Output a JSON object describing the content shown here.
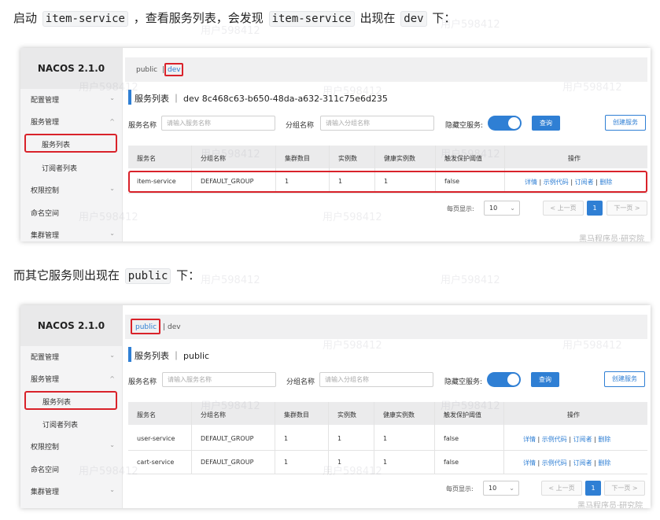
{
  "para1": {
    "prefix": "启动",
    "code1": "item-service",
    "middle": "，查看服务列表，会发现",
    "code2": "item-service",
    "middle2": "出现在",
    "code3": "dev",
    "suffix": "下："
  },
  "para2": {
    "prefix": "而其它服务则出现在",
    "code1": "public",
    "suffix": "下："
  },
  "shot1": {
    "logo": "NACOS 2.1.0",
    "menu": {
      "config": "配置管理",
      "service": "服务管理",
      "service_list": "服务列表",
      "subscriber_list": "订阅者列表",
      "auth": "权限控制",
      "namespace": "命名空间",
      "cluster": "集群管理"
    },
    "ns": {
      "public": "public",
      "sep": "|",
      "dev": "dev"
    },
    "title": "服务列表 ｜ dev  8c468c63-b650-48da-a632-311c75e6d235",
    "filters": {
      "service_label": "服务名称",
      "service_ph": "请输入服务名称",
      "group_label": "分组名称",
      "group_ph": "请输入分组名称",
      "hide_label": "隐藏空服务:",
      "query": "查询",
      "create": "创建服务"
    },
    "headers": [
      "服务名",
      "分组名称",
      "集群数目",
      "实例数",
      "健康实例数",
      "触发保护阈值",
      "操作"
    ],
    "rows": [
      {
        "name": "item-service",
        "group": "DEFAULT_GROUP",
        "clusters": "1",
        "instances": "1",
        "healthy": "1",
        "threshold": "false"
      }
    ],
    "ops": {
      "detail": "详情",
      "sample": "示例代码",
      "subscriber": "订阅者",
      "delete": "删除",
      "sep": "|"
    },
    "pager": {
      "label": "每页显示:",
      "size": "10",
      "prev": "< 上一页",
      "page": "1",
      "next": "下一页 >"
    },
    "footer_wm": "黑马程序员·研究院"
  },
  "shot2": {
    "logo": "NACOS 2.1.0",
    "menu": {
      "config": "配置管理",
      "service": "服务管理",
      "service_list": "服务列表",
      "subscriber_list": "订阅者列表",
      "auth": "权限控制",
      "namespace": "命名空间",
      "cluster": "集群管理"
    },
    "ns": {
      "public": "public",
      "sep": "|",
      "dev": "dev"
    },
    "title": "服务列表 ｜ public",
    "filters": {
      "service_label": "服务名称",
      "service_ph": "请输入服务名称",
      "group_label": "分组名称",
      "group_ph": "请输入分组名称",
      "hide_label": "隐藏空服务:",
      "query": "查询",
      "create": "创建服务"
    },
    "headers": [
      "服务名",
      "分组名称",
      "集群数目",
      "实例数",
      "健康实例数",
      "触发保护阈值",
      "操作"
    ],
    "rows": [
      {
        "name": "user-service",
        "group": "DEFAULT_GROUP",
        "clusters": "1",
        "instances": "1",
        "healthy": "1",
        "threshold": "false"
      },
      {
        "name": "cart-service",
        "group": "DEFAULT_GROUP",
        "clusters": "1",
        "instances": "1",
        "healthy": "1",
        "threshold": "false"
      }
    ],
    "ops": {
      "detail": "详情",
      "sample": "示例代码",
      "subscriber": "订阅者",
      "delete": "删除",
      "sep": "|"
    },
    "pager": {
      "label": "每页显示:",
      "size": "10",
      "prev": "< 上一页",
      "page": "1",
      "next": "下一页 >"
    },
    "footer_wm": "黑马程序员·研究院"
  },
  "watermark": "用户598412",
  "colors": {
    "accent": "#2f7fd4",
    "highlight": "#d9222a"
  }
}
